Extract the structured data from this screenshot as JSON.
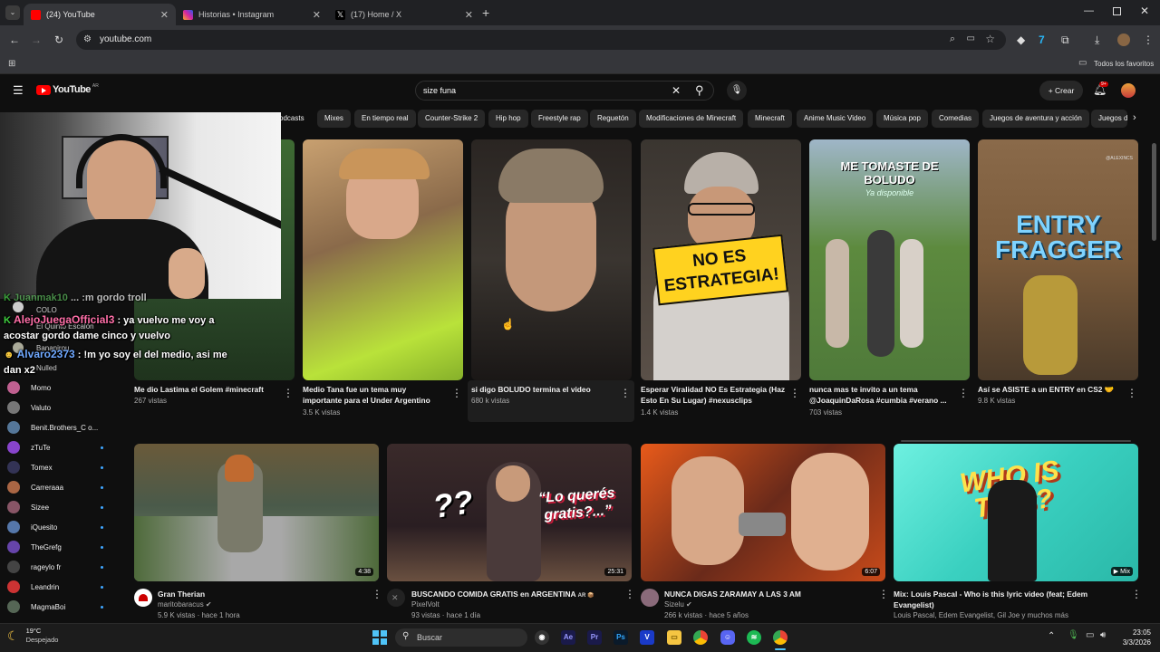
{
  "browser": {
    "tabs": [
      {
        "title": "(24) YouTube",
        "color": "#ff0000"
      },
      {
        "title": "Historias • Instagram",
        "color": "#d6249f"
      },
      {
        "title": "(17) Home / X",
        "color": "#000000"
      }
    ],
    "new_tab": "+",
    "url": "youtube.com",
    "bookmarks_label": "Todos los favoritos"
  },
  "youtube": {
    "logo_text": "YouTube",
    "region": "AR",
    "search_value": "size funa",
    "create_label": "Crear",
    "notif_count": "9+",
    "chips": [
      "odcasts",
      "Mixes",
      "En tiempo real",
      "Counter-Strike 2",
      "Hip hop",
      "Freestyle rap",
      "Reguetón",
      "Modificaciones de Minecraft",
      "Minecraft",
      "Anime Music Video",
      "Música pop",
      "Comedias",
      "Juegos de aventura y acción",
      "Juegos d"
    ]
  },
  "sidebar": {
    "items": [
      {
        "label": "Momo",
        "color": "#c06090"
      },
      {
        "label": "Valuto",
        "color": "#777777"
      },
      {
        "label": "Benit.Brothers_C o...",
        "color": "#557799"
      },
      {
        "label": "zTuTe",
        "color": "#8844cc"
      },
      {
        "label": "Tomex",
        "color": "#333355"
      },
      {
        "label": "Carreraaa",
        "color": "#aa6644"
      },
      {
        "label": "Sizee",
        "color": "#885566"
      },
      {
        "label": "iQuesito",
        "color": "#5577aa"
      },
      {
        "label": "TheGrefg",
        "color": "#6644aa"
      },
      {
        "label": "rageylo fr",
        "color": "#444444"
      },
      {
        "label": "Leandrin",
        "color": "#cc3333"
      },
      {
        "label": "MagmaBoi",
        "color": "#556655"
      }
    ],
    "hidden_items": [
      "COLO",
      "El Quinto Escalón",
      "Bananirou",
      "Nulled"
    ]
  },
  "chat": [
    {
      "user": "Juanmak10",
      "text": "... :m gordo troll",
      "color": "#5fbf5f"
    },
    {
      "user": "AlejoJuegaOfficial3",
      "text": ": ya vuelvo me voy a acostar gordo dame cinco y vuelvo",
      "color": "#ff6fa8"
    },
    {
      "user": "Alvaro2373",
      "text": ": !m yo soy el del medio, asi me dan x2",
      "color": "#6fa8ff"
    }
  ],
  "videos_row1": [
    {
      "title": "Me dio Lastima el Golem #minecraft",
      "meta": "267 vistas",
      "bg": "#2c4a2a"
    },
    {
      "title": "Medio Tana fue un tema muy importante para el Under Argentino",
      "meta": "3.5 K vistas",
      "bg": "#7c6c58"
    },
    {
      "title": "si digo BOLUDO termina el video",
      "meta": "680 k vistas",
      "bg": "#3a3530"
    },
    {
      "title": "Esperar Viralidad NO Es Estrategia (Haz Esto En Su Lugar) #nexusclips",
      "meta": "1.4 K vistas",
      "bg": "#504840",
      "overlay": "NO ES ESTRATEGIA!"
    },
    {
      "title": "nunca mas te invito a un tema @JoaquinDaRosa #cumbia #verano ...",
      "meta": "703 vistas",
      "bg": "#4f7a3a",
      "overlay": "ME TOMASTE DE BOLUDO",
      "overlay_sub": "Ya disponible"
    },
    {
      "title": "Así se ASISTE a un ENTRY en CS2 🤝",
      "meta": "9.8 K vistas",
      "bg": "#7a5a3a",
      "overlay": "ENTRY FRAGGER",
      "watermark": "@ALEXINCS"
    }
  ],
  "videos_row2": [
    {
      "title": "Gran Therian",
      "channel": "maritobaracus",
      "meta": "5.9 K vistas · hace 1 hora",
      "duration": "4:38",
      "bg": "#4a5a4a",
      "verified": true
    },
    {
      "title": "BUSCANDO COMIDA GRATIS en ARGENTINA",
      "badge": "AR 📦",
      "channel": "PixelVolt",
      "meta": "93 vistas · hace 1 día",
      "duration": "25:31",
      "bg": "#2a1e22",
      "overlay": "“Lo querés gratis?...”",
      "overlay_q": "??"
    },
    {
      "title": "NUNCA DIGAS ZARAMAY A LAS 3 AM",
      "channel": "Sizelu",
      "meta": "266 k vistas · hace 5 años",
      "duration": "6:07",
      "bg": "#6a2a1a",
      "verified": true
    },
    {
      "title": "Mix: Louis Pascal - Who is this lyric video (feat; Edem Evangelist)",
      "meta": "Louis Pascal, Edem Evangelist, Gil Joe y muchos más",
      "duration": "Mix",
      "bg": "#3ad0c0",
      "overlay": "WHO IS THIS?"
    }
  ],
  "taskbar": {
    "weather_temp": "19°C",
    "weather_desc": "Despejado",
    "search_label": "Buscar",
    "time": "23:05",
    "date": "3/3/2026"
  }
}
